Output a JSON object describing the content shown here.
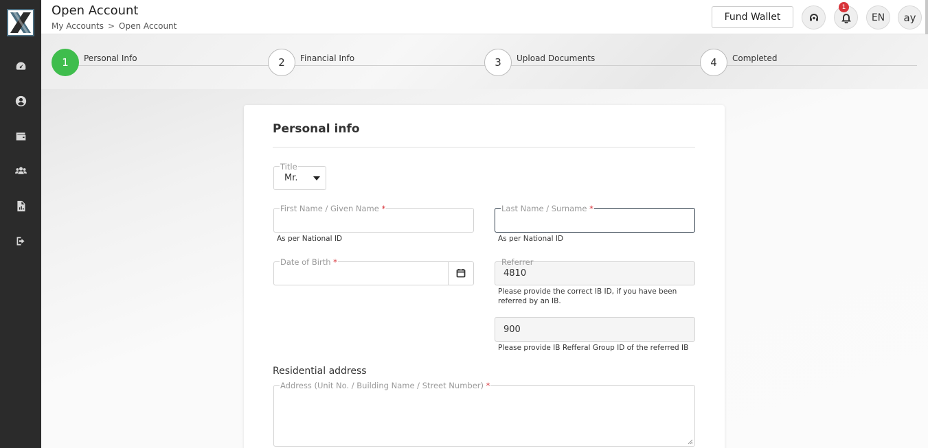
{
  "header": {
    "title": "Open Account",
    "breadcrumb": [
      "My Accounts",
      "Open Account"
    ],
    "breadcrumb_sep": ">",
    "fund_wallet": "Fund Wallet",
    "notification_count": "1",
    "language": "EN",
    "user_initials": "ay"
  },
  "sidebar": {
    "items": [
      "dashboard-icon",
      "user-icon",
      "wallet-icon",
      "team-icon",
      "report-icon",
      "logout-icon"
    ]
  },
  "stepper": {
    "steps": [
      {
        "number": "1",
        "label": "Personal Info",
        "active": true
      },
      {
        "number": "2",
        "label": "Financial Info",
        "active": false
      },
      {
        "number": "3",
        "label": "Upload Documents",
        "active": false
      },
      {
        "number": "4",
        "label": "Completed",
        "active": false
      }
    ]
  },
  "form": {
    "heading": "Personal info",
    "title_label": "Title",
    "title_value": "Mr.",
    "first_name_label": "First Name / Given Name",
    "first_name_hint": "As per National ID",
    "last_name_label": "Last Name / Surname",
    "last_name_hint": "As per National ID",
    "dob_label": "Date of Birth",
    "referrer_label": "Referrer",
    "referrer_value": "4810",
    "referrer_hint": "Please provide the correct IB ID, if you have been referred by an IB.",
    "group_value": "900",
    "group_hint": "Please provide IB Refferal Group ID of the referred IB",
    "address_section": "Residential address",
    "address_label": "Address (Unit No. / Building Name / Street Number)",
    "required_mark": "*"
  },
  "colors": {
    "sidebar": "#2b2b2b",
    "step_active": "#3fbd4d",
    "required": "#d8343a",
    "badge": "#d8343a"
  }
}
